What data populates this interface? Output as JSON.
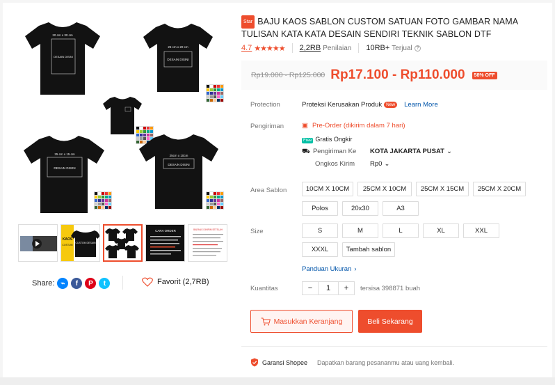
{
  "gallery": {
    "main_print_labels": {
      "tl_size": "20 cm x 30 cm",
      "tl_text": "DESAIN DISINI",
      "tr_size": "25 cm x 20 cm",
      "tr_text": "DESAIN DISINI",
      "bl_size": "25 cm x 15 cm",
      "bl_text": "DESAIN DISINI",
      "br_size": "25cm x 10cm",
      "br_text": "DESAIN DISINI",
      "swatch_title": "WARNA KAOS"
    },
    "thumbs": {
      "kaos_top": "KAOS",
      "kaos_side": "COSTUM",
      "kaos_mid": "CUSTOM DESAIN",
      "order_title": "CARA ORDER",
      "info_title": "BARANG DIKIRIM SETELAH"
    }
  },
  "share": {
    "label": "Share:"
  },
  "favorite": {
    "label": "Favorit (2,7RB)"
  },
  "product": {
    "star_badge": "Star",
    "title": "BAJU KAOS SABLON CUSTOM SATUAN FOTO GAMBAR NAMA TULISAN KATA KATA DESAIN SENDIRI TEKNIK SABLON DTF",
    "rating_value": "4.7",
    "stars": "★★★★★",
    "review_count": "2,2RB",
    "review_label": "Penilaian",
    "sold_count": "10RB+",
    "sold_label": "Terjual"
  },
  "price": {
    "old": "Rp19.000 - Rp125.000",
    "new": "Rp17.100 - Rp110.000",
    "discount": "58% OFF"
  },
  "protection": {
    "label": "Protection",
    "value": "Proteksi Kerusakan Produk",
    "new_tag": "New",
    "learn_more": "Learn More"
  },
  "shipping": {
    "label": "Pengiriman",
    "preorder": "Pre-Order (dikirim dalam 7 hari)",
    "free_tag": "Free",
    "free": "Gratis Ongkir",
    "ship_to_label": "Pengiriman Ke",
    "ship_to_value": "KOTA JAKARTA PUSAT",
    "cost_label": "Ongkos Kirim",
    "cost_value": "Rp0"
  },
  "area_sablon": {
    "label": "Area Sablon",
    "options": [
      "10CM X 10CM",
      "25CM X 10CM",
      "25CM X 15CM",
      "25CM X 20CM",
      "Polos",
      "20x30",
      "A3"
    ]
  },
  "size": {
    "label": "Size",
    "options": [
      "S",
      "M",
      "L",
      "XL",
      "XXL",
      "XXXL",
      "Tambah sablon"
    ],
    "guide": "Panduan Ukuran"
  },
  "quantity": {
    "label": "Kuantitas",
    "value": "1",
    "minus": "−",
    "plus": "+",
    "stock": "tersisa 398871 buah"
  },
  "actions": {
    "add_to_cart": "Masukkan Keranjang",
    "buy_now": "Beli Sekarang"
  },
  "guarantee": {
    "label": "Garansi Shopee",
    "description": "Dapatkan barang pesananmu atau uang kembali."
  },
  "colors": {
    "accent": "#ee4d2d",
    "link": "#0055aa",
    "teal": "#00bfa5"
  }
}
